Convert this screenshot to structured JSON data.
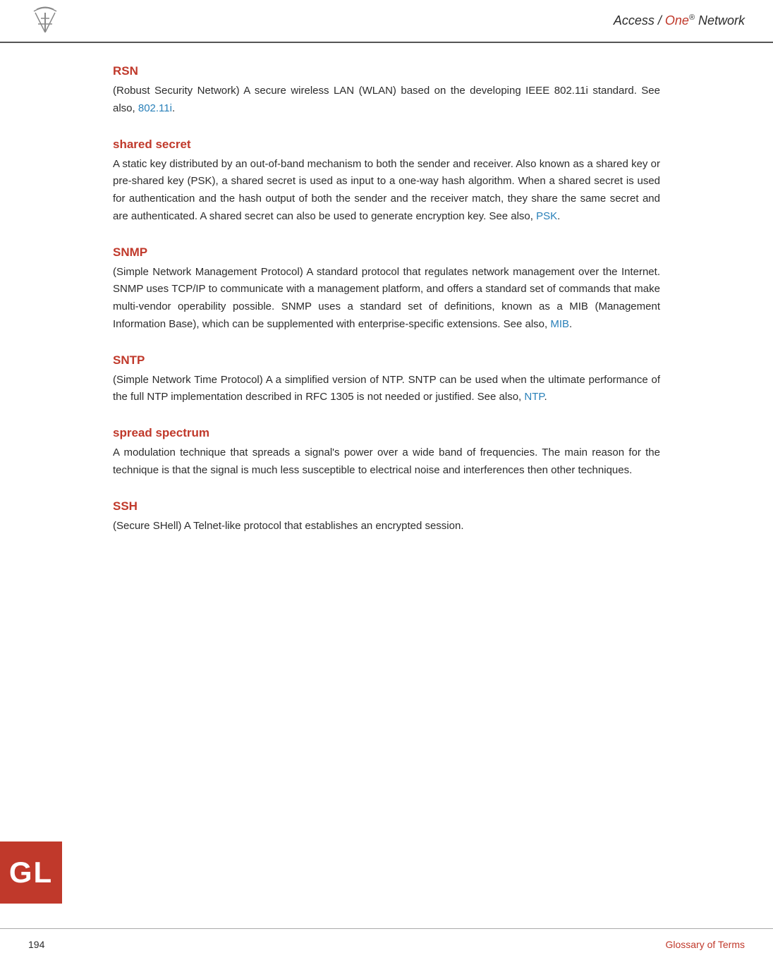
{
  "header": {
    "title_prefix": "Access / ",
    "title_brand": "One",
    "title_suffix": " Network",
    "superscript": "®"
  },
  "entries": [
    {
      "id": "rsn",
      "title": "RSN",
      "body": "(Robust Security Network) A secure wireless LAN (WLAN) based on the developing IEEE 802.11i standard. See also, ",
      "body_after": ".",
      "link_text": "802.11i",
      "link_ref": "802.11i"
    },
    {
      "id": "shared-secret",
      "title": "shared secret",
      "body": "A static key distributed by an out-of-band mechanism to both the sender and receiver. Also known as a shared key or pre-shared key (PSK), a shared secret is used as input to a one-way hash algorithm. When a shared secret is used for authentication and the hash output of both the sender and the receiver match, they share the same secret and are authenticated. A shared secret can also be used to generate encryption key. See also, ",
      "body_after": ".",
      "link_text": "PSK",
      "link_ref": "PSK"
    },
    {
      "id": "snmp",
      "title": "SNMP",
      "body": "(Simple Network Management Protocol) A standard protocol that regulates network management over the Internet. SNMP uses TCP/IP to communicate with a management platform, and offers a standard set of commands that make multi-vendor operability possible. SNMP uses a standard set of definitions, known as a MIB (Management Information Base), which can be supplemented with enterprise-specific extensions. See also, ",
      "body_after": ".",
      "link_text": "MIB",
      "link_ref": "MIB"
    },
    {
      "id": "sntp",
      "title": "SNTP",
      "body": "(Simple Network Time Protocol) A a simplified version of NTP. SNTP can be used when the ultimate performance of the full NTP implementation described in RFC 1305 is not needed or justified. See also, ",
      "body_after": ".",
      "link_text": "NTP",
      "link_ref": "NTP"
    },
    {
      "id": "spread-spectrum",
      "title": "spread spectrum",
      "body": "A modulation technique that spreads a signal's power over a wide band of frequencies. The main reason for the technique is that the signal is much less susceptible to electrical noise and interferences then other techniques.",
      "body_after": "",
      "link_text": "",
      "link_ref": ""
    },
    {
      "id": "ssh",
      "title": "SSH",
      "body": "(Secure SHell) A Telnet-like protocol that establishes an encrypted session.",
      "body_after": "",
      "link_text": "",
      "link_ref": ""
    }
  ],
  "gl_badge": {
    "label": "GL"
  },
  "footer": {
    "page_number": "194",
    "section_label": "Glossary of Terms"
  }
}
